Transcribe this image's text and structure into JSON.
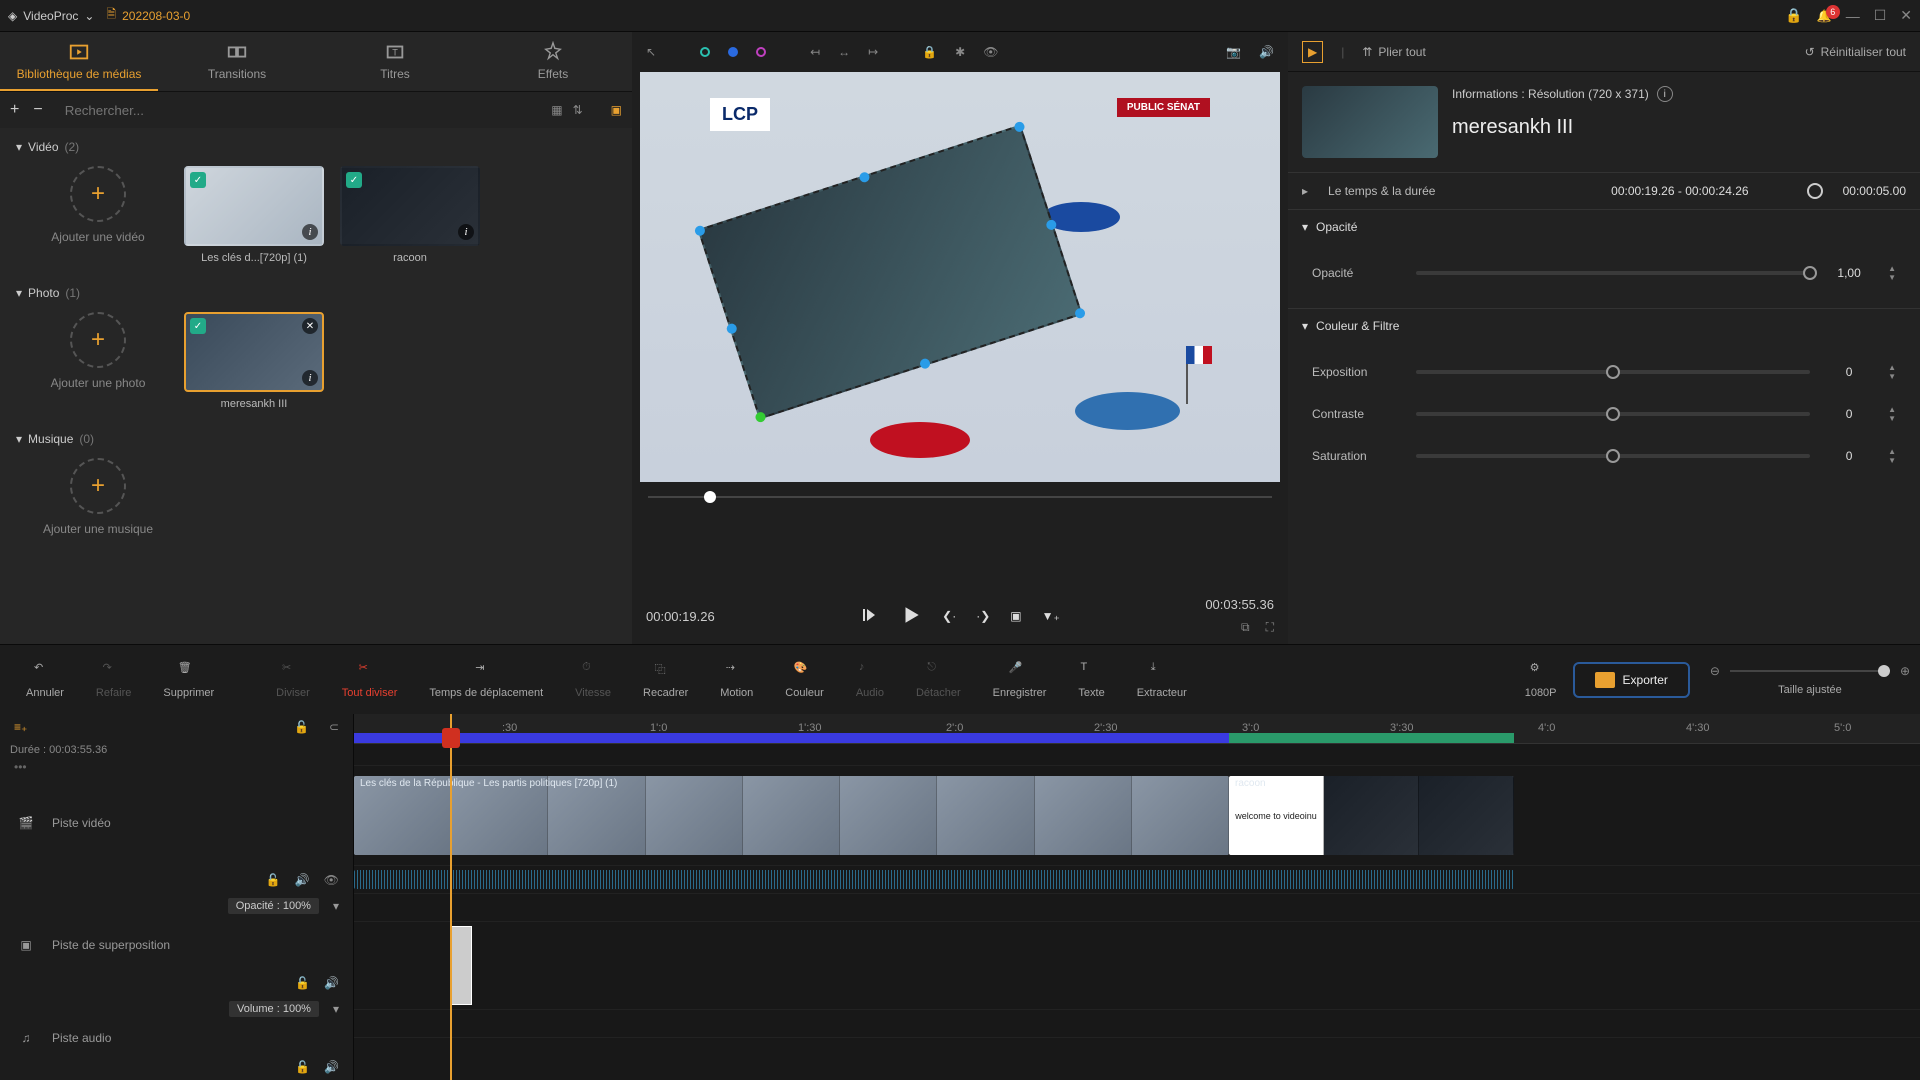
{
  "titlebar": {
    "app_name": "VideoProc",
    "project": "202208-03-0",
    "notif_count": "6"
  },
  "library": {
    "tabs": {
      "media": "Bibliothèque de médias",
      "transitions": "Transitions",
      "titles": "Titres",
      "effects": "Effets"
    },
    "search_placeholder": "Rechercher...",
    "plus": "+",
    "minus": "−",
    "video": {
      "label": "Vidéo",
      "count": "(2)",
      "add_label": "Ajouter une vidéo",
      "items": [
        "Les clés d...[720p] (1)",
        "racoon"
      ]
    },
    "photo": {
      "label": "Photo",
      "count": "(1)",
      "add_label": "Ajouter une photo",
      "items": [
        "meresankh III"
      ]
    },
    "music": {
      "label": "Musique",
      "count": "(0)",
      "add_label": "Ajouter une musique"
    }
  },
  "preview": {
    "lcp": "LCP",
    "senat": "PUBLIC SÉNAT",
    "current_time": "00:00:19.26",
    "total_time": "00:03:55.36"
  },
  "properties": {
    "collapse_all": "Plier tout",
    "reset_all": "Réinitialiser tout",
    "info_label": "Informations : Résolution (720 x 371)",
    "clip_name": "meresankh III",
    "time_section": "Le temps & la durée",
    "time_range": "00:00:19.26 - 00:00:24.26",
    "duration": "00:00:05.00",
    "opacity_section": "Opacité",
    "opacity_label": "Opacité",
    "opacity_val": "1,00",
    "color_section": "Couleur & Filtre",
    "exposure": "Exposition",
    "contrast": "Contraste",
    "saturation": "Saturation",
    "zero": "0"
  },
  "tools": {
    "undo": "Annuler",
    "redo": "Refaire",
    "delete": "Supprimer",
    "split": "Diviser",
    "split_all": "Tout diviser",
    "ripple": "Temps de déplacement",
    "speed": "Vitesse",
    "crop": "Recadrer",
    "motion": "Motion",
    "color": "Couleur",
    "audio": "Audio",
    "detach": "Détacher",
    "record": "Enregistrer",
    "text": "Texte",
    "extract": "Extracteur",
    "res": "1080P",
    "export": "Exporter",
    "zoom_label": "Taille ajustée"
  },
  "timeline": {
    "duration_label": "Durée :",
    "duration_val": "00:03:55.36",
    "playhead_time": "00:00:19.26",
    "marks": [
      ":30",
      "1':0",
      "1':30",
      "2':0",
      "2':30",
      "3':0",
      "3':30",
      "4':0",
      "4':30",
      "5':0"
    ],
    "track_video": "Piste vidéo",
    "track_overlay": "Piste de superposition",
    "track_audio": "Piste audio",
    "opacity_chip": "Opacité : 100%",
    "volume_chip": "Volume : 100%",
    "clip1_label": "Les clés de la République - Les partis politiques [720p] (1)",
    "clip2_label": "racoon",
    "welcome": "welcome to videoinu"
  }
}
